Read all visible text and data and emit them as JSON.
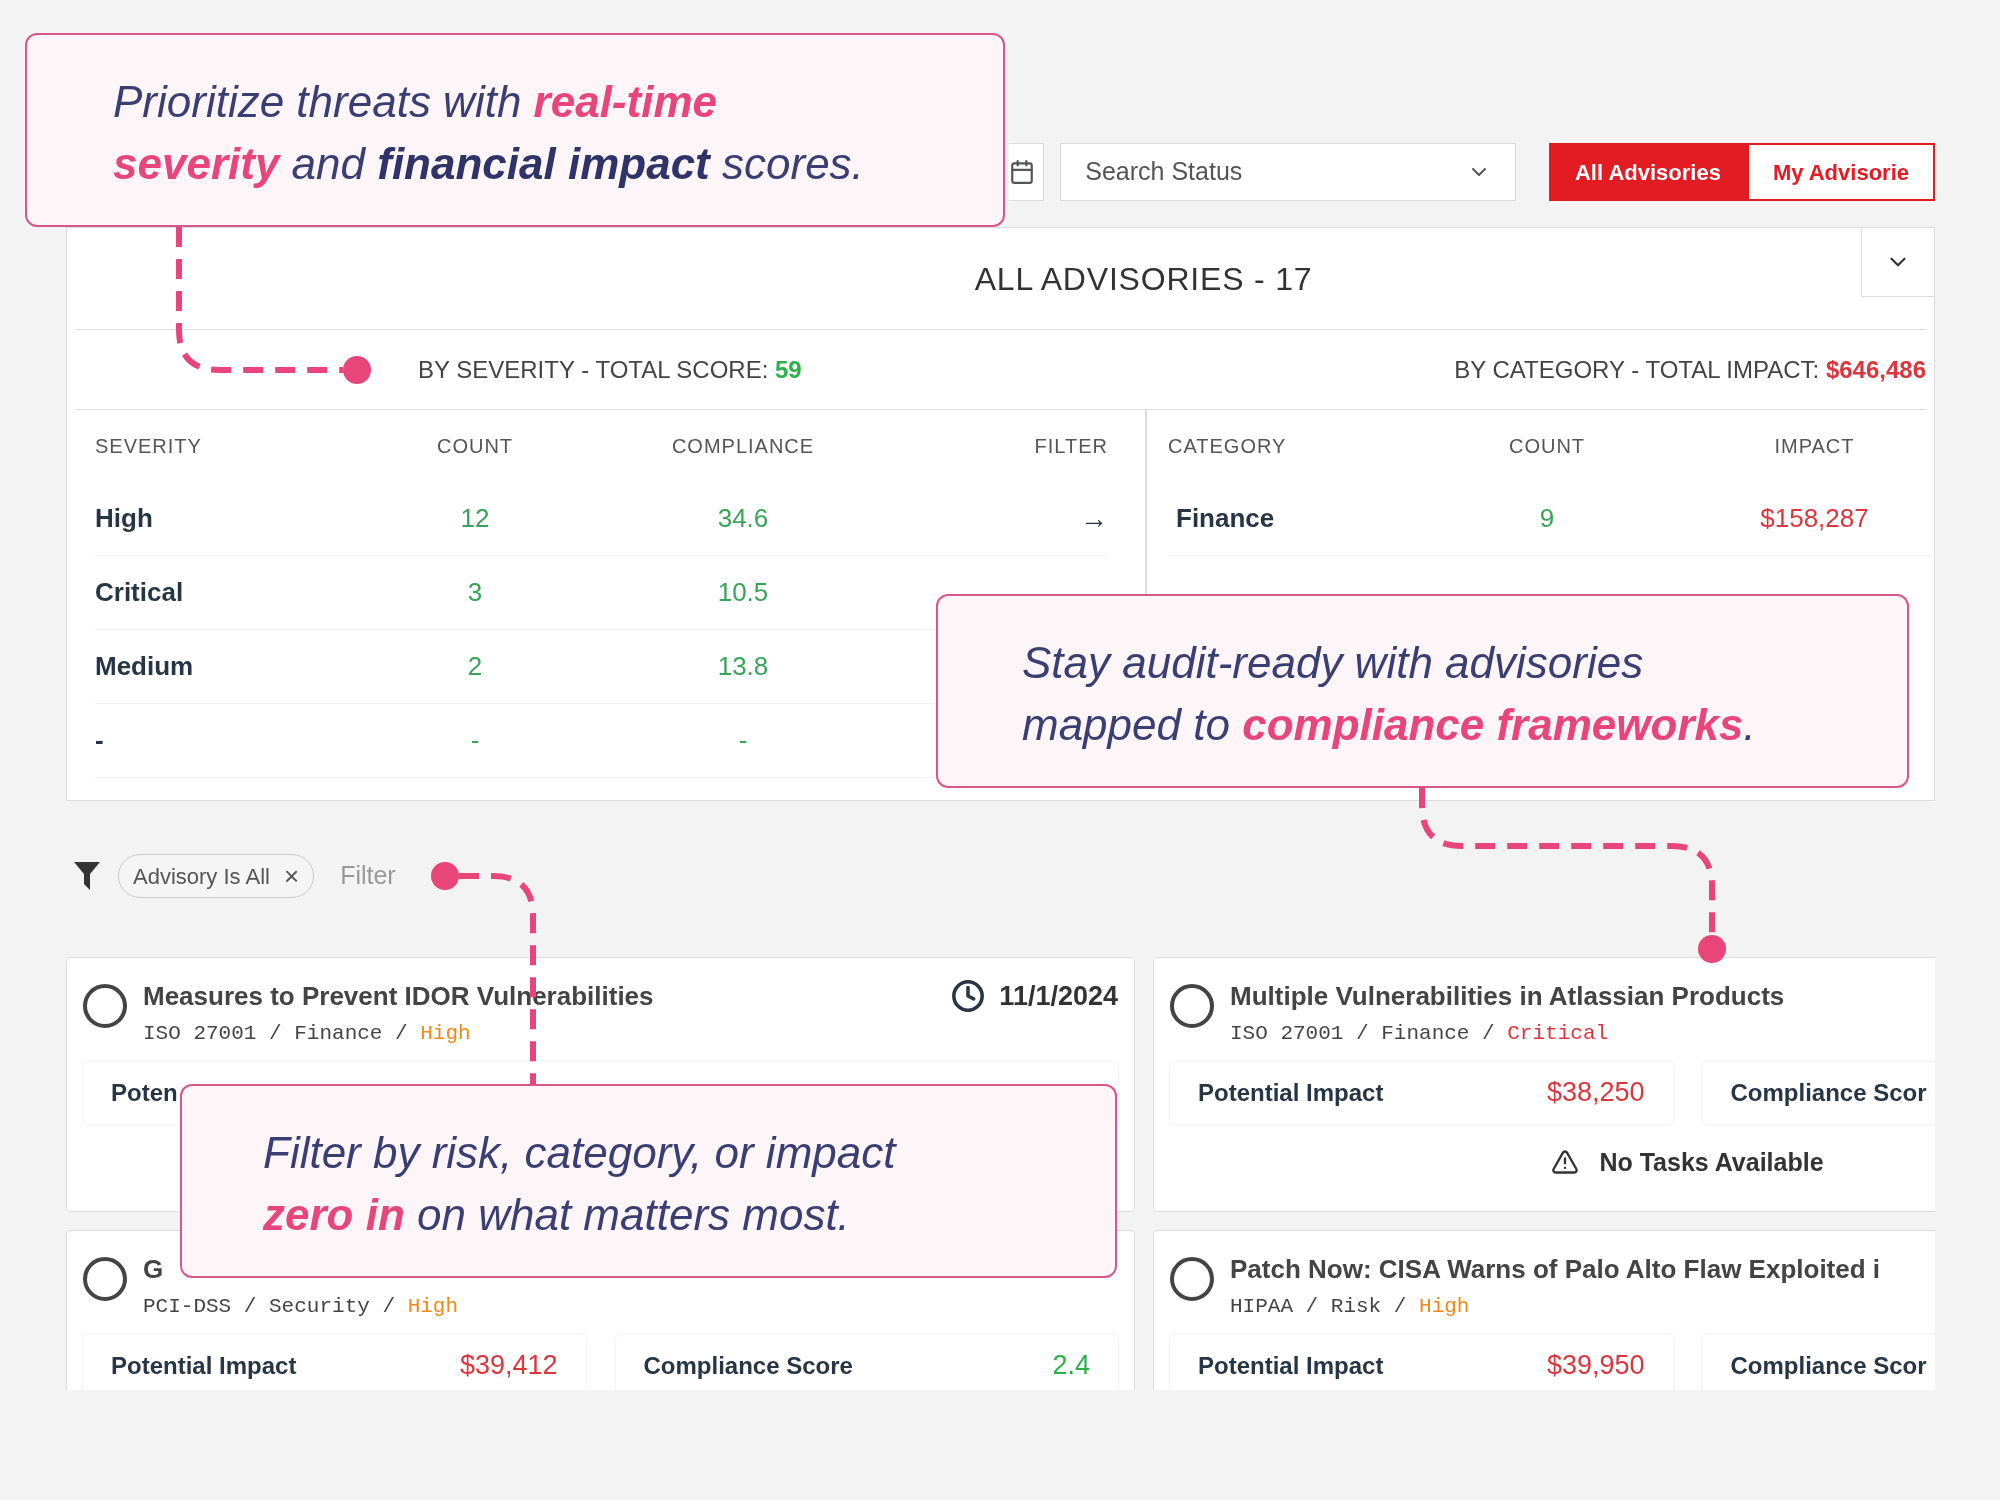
{
  "toolbar": {
    "status_select": {
      "placeholder": "Search Status"
    },
    "tabs": [
      {
        "label": "All Advisories",
        "selected": true
      },
      {
        "label": "My Advisorie",
        "selected": false
      }
    ]
  },
  "panel": {
    "title": "ALL ADVISORIES - 17",
    "severity_summary": {
      "label": "BY SEVERITY - TOTAL SCORE:",
      "value": "59"
    },
    "category_summary": {
      "label": "BY CATEGORY - TOTAL IMPACT:",
      "value": "$646,486"
    },
    "severity_table": {
      "columns": [
        "SEVERITY",
        "COUNT",
        "COMPLIANCE",
        "FILTER"
      ],
      "rows": [
        {
          "severity": "High",
          "count": "12",
          "compliance": "34.6",
          "filter": "→"
        },
        {
          "severity": "Critical",
          "count": "3",
          "compliance": "10.5"
        },
        {
          "severity": "Medium",
          "count": "2",
          "compliance": "13.8"
        },
        {
          "severity": "-",
          "count": "-",
          "compliance": "-"
        }
      ]
    },
    "category_table": {
      "columns": [
        "CATEGORY",
        "COUNT",
        "IMPACT"
      ],
      "rows": [
        {
          "category": "Finance",
          "count": "9",
          "impact": "$158,287"
        }
      ]
    }
  },
  "filter_bar": {
    "chips": [
      {
        "label": "Advisory Is All",
        "remove": "×"
      }
    ],
    "input": {
      "placeholder": "Filter"
    }
  },
  "cards": [
    {
      "title": "Measures to Prevent IDOR Vulnerabilities",
      "selected": false,
      "date": "11/1/2024",
      "path": "ISO 27001 / Finance /",
      "severity": {
        "text": "High",
        "color": "#f0891c"
      },
      "metrics": [
        {
          "label": "Poten"
        }
      ]
    },
    {
      "title": "Multiple Vulnerabilities in Atlassian Products",
      "selected": false,
      "path": "ISO 27001 / Finance /",
      "severity": {
        "text": "Critical",
        "color": "#d9363e"
      },
      "metrics": [
        {
          "label": "Potential Impact",
          "value": "$38,250"
        },
        {
          "label": "Compliance Scor"
        }
      ],
      "notice": "No Tasks Available"
    },
    {
      "title": "G",
      "selected": false,
      "path": "PCI-DSS / Security /",
      "severity": {
        "text": "High",
        "color": "#f0891c"
      },
      "metrics": [
        {
          "label": "Potential Impact",
          "value": "$39,412"
        },
        {
          "label": "Compliance Score",
          "value": "2.4"
        }
      ]
    },
    {
      "title": "Patch Now: CISA Warns of Palo Alto Flaw Exploited i",
      "selected": false,
      "path": "HIPAA / Risk /",
      "severity": {
        "text": "High",
        "color": "#f0891c"
      },
      "metrics": [
        {
          "label": "Potential Impact",
          "value": "$39,950"
        },
        {
          "label": "Compliance Scor"
        }
      ]
    }
  ],
  "callouts": [
    {
      "lines": [
        [
          {
            "text": "Prioritize threats with ",
            "kind": "plain"
          },
          {
            "text": "real-time",
            "kind": "accent"
          }
        ],
        [
          {
            "text": "severity",
            "kind": "accent"
          },
          {
            "text": " and ",
            "kind": "plain"
          },
          {
            "text": "financial impact",
            "kind": "strong"
          },
          {
            "text": " scores.",
            "kind": "plain"
          }
        ]
      ]
    },
    {
      "lines": [
        [
          {
            "text": "Stay audit-ready with advisories",
            "kind": "plain"
          }
        ],
        [
          {
            "text": "mapped to ",
            "kind": "plain"
          },
          {
            "text": "compliance frameworks",
            "kind": "accent"
          },
          {
            "text": ".",
            "kind": "plain"
          }
        ]
      ]
    },
    {
      "lines": [
        [
          {
            "text": "Filter by risk, category, or impact",
            "kind": "plain"
          }
        ],
        [
          {
            "text": "zero in",
            "kind": "accent"
          },
          {
            "text": " on what matters most.",
            "kind": "plain"
          }
        ]
      ]
    }
  ]
}
